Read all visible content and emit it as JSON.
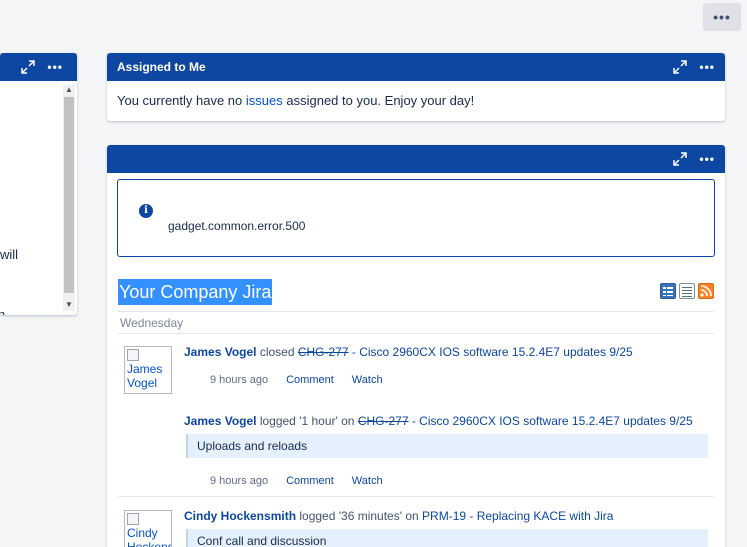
{
  "top_more_label": "•••",
  "left_gadget": {
    "dots": "•••",
    "text_line1": "will",
    "text_line2": "n."
  },
  "assigned_gadget": {
    "title": "Assigned to Me",
    "dots": "•••",
    "message_before": "You currently have no ",
    "message_link": "issues",
    "message_after": " assigned to you. Enjoy your day!"
  },
  "activity_gadget": {
    "title": "",
    "dots": "•••",
    "error_icon": "i",
    "error_text": "gadget.common.error.500",
    "stream_title": "Your Company Jira",
    "stream_icons": [
      "list-view-icon",
      "full-view-icon",
      "rss-icon"
    ],
    "day_label": "Wednesday",
    "entries": [
      {
        "avatar_alt": "James Vogel",
        "user": "James Vogel",
        "action": " closed ",
        "issue_key": "CHG-277",
        "issue_title": " - Cisco 2960CX IOS software 15.2.4E7 updates 9/25",
        "time": "9 hours ago",
        "comment_link": "Comment",
        "watch_link": "Watch"
      },
      {
        "user": "James Vogel",
        "action": " logged '1 hour' on ",
        "issue_key": "CHG-277",
        "issue_title": " - Cisco 2960CX IOS software 15.2.4E7 updates 9/25",
        "comment": "Uploads and reloads",
        "time": "9 hours ago",
        "comment_link": "Comment",
        "watch_link": "Watch"
      },
      {
        "avatar_alt": "Cindy Hockensmith",
        "user": "Cindy Hockensmith",
        "action": " logged '36 minutes' on ",
        "issue_link": "PRM-19 - Replacing KACE with Jira",
        "comment": "Conf call and discussion"
      }
    ]
  },
  "colors": {
    "header_blue": "#0d47a1",
    "link_blue": "#0052cc",
    "selection_blue": "#3390ff",
    "comment_bg": "#e4f0fb"
  }
}
